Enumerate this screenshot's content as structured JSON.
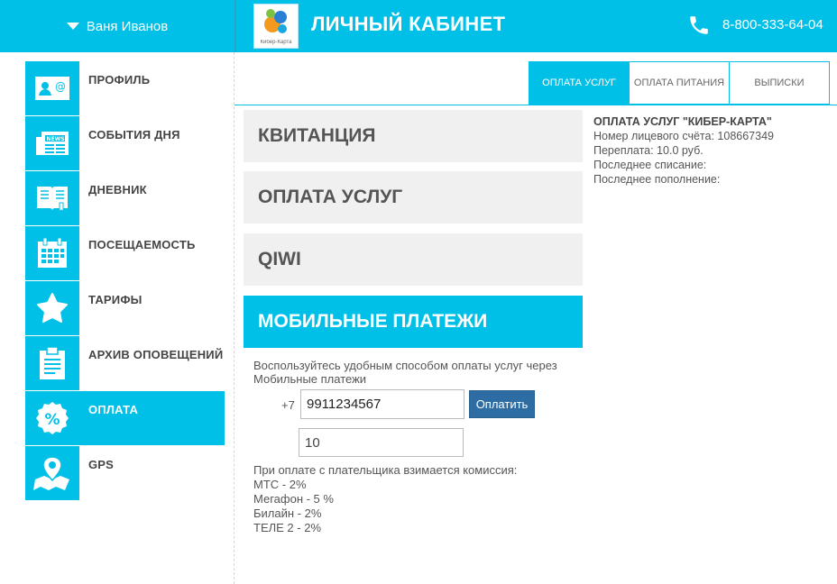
{
  "header": {
    "user_name": "Ваня Иванов",
    "title": "ЛИЧНЫЙ КАБИНЕТ",
    "phone": "8-800-333-64-04",
    "logo_text": "Кибер-Карта",
    "accent_color": "#00c0e8"
  },
  "sidebar": {
    "items": [
      {
        "label": "ПРОФИЛЬ",
        "icon": "profile-card-icon"
      },
      {
        "label": "СОБЫТИЯ ДНЯ",
        "icon": "newspaper-icon"
      },
      {
        "label": "ДНЕВНИК",
        "icon": "book-icon"
      },
      {
        "label": "ПОСЕЩАЕМОСТЬ",
        "icon": "calendar-icon"
      },
      {
        "label": "ТАРИФЫ",
        "icon": "star-icon"
      },
      {
        "label": "АРХИВ ОПОВЕЩЕНИЙ",
        "icon": "clipboard-icon"
      },
      {
        "label": "ОПЛАТА",
        "icon": "percent-badge-icon",
        "active": true
      },
      {
        "label": "GPS",
        "icon": "map-pin-icon"
      }
    ]
  },
  "tabs": [
    {
      "label": "ОПЛАТА УСЛУГ",
      "active": true
    },
    {
      "label": "ОПЛАТА ПИТАНИЯ"
    },
    {
      "label": "ВЫПИСКИ"
    }
  ],
  "accordion": [
    {
      "label": "КВИТАНЦИЯ"
    },
    {
      "label": "ОПЛАТА УСЛУГ"
    },
    {
      "label": "QIWI"
    },
    {
      "label": "МОБИЛЬНЫЕ ПЛАТЕЖИ",
      "active": true
    }
  ],
  "mobile": {
    "description": "Воспользуйтесь удобным способом оплаты услуг через Мобильные платежи",
    "prefix": "+7",
    "phone_value": "9911234567",
    "pay_label": "Оплатить",
    "amount_value": "10",
    "commission_title": "При оплате с плательщика взимается комиссия:",
    "commission": [
      "МТС - 2%",
      "Мегафон - 5 %",
      "Билайн - 2%",
      "ТЕЛЕ 2 - 2%"
    ]
  },
  "account": {
    "title": "ОПЛАТА УСЛУГ \"КИБЕР-КАРТА\"",
    "number": "Номер лицевого счёта: 108667349",
    "overpay": "Переплата: 10.0 руб.",
    "last_debit": "Последнее списание:",
    "last_topup": "Последнее пополнение:"
  }
}
